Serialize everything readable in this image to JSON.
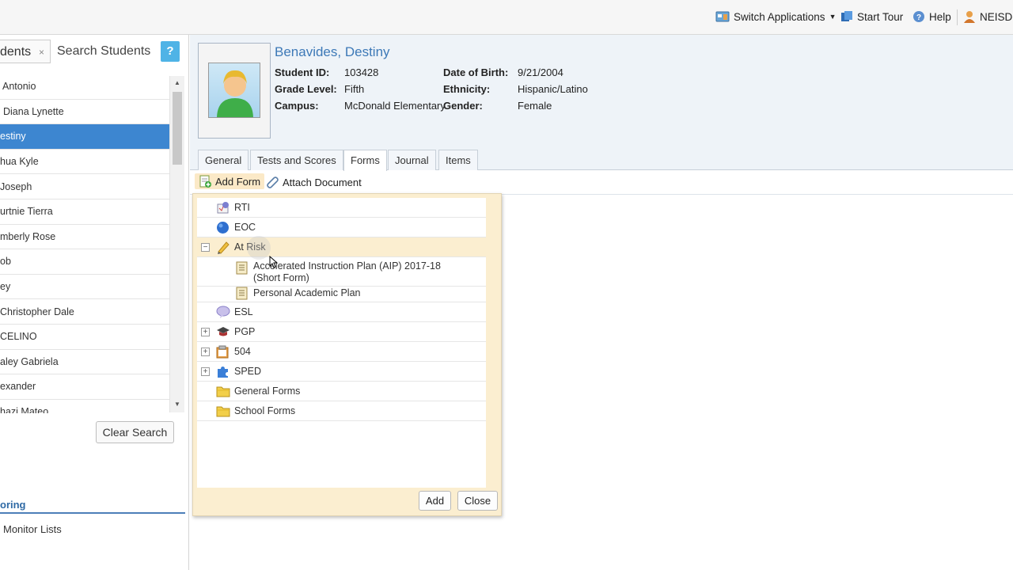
{
  "topbar": {
    "switch_apps": "Switch Applications",
    "start_tour": "Start Tour",
    "help": "Help",
    "user": "NEISD"
  },
  "left": {
    "tab_label": "dents",
    "tab_close": "×",
    "search_label": "Search Students",
    "help_btn": "?",
    "students": [
      {
        "name": "Antonio",
        "indent": 3
      },
      {
        "name": "Diana Lynette",
        "indent": 4
      },
      {
        "name": "estiny",
        "indent": 0,
        "selected": true
      },
      {
        "name": "hua Kyle",
        "indent": 0
      },
      {
        "name": "Joseph",
        "indent": 0
      },
      {
        "name": "urtnie Tierra",
        "indent": 0
      },
      {
        "name": "mberly Rose",
        "indent": 0
      },
      {
        "name": "ob",
        "indent": 0
      },
      {
        "name": "ey",
        "indent": 0
      },
      {
        "name": "Christopher Dale",
        "indent": 0
      },
      {
        "name": "CELINO",
        "indent": 0
      },
      {
        "name": "aley Gabriela",
        "indent": 0
      },
      {
        "name": "exander",
        "indent": 0
      },
      {
        "name": "hazi Mateo",
        "indent": 0
      }
    ],
    "clear_search": "Clear Search",
    "section_heading": "oring",
    "monitor_lists": "Monitor Lists"
  },
  "student": {
    "name": "Benavides, Destiny",
    "id_label": "Student ID:",
    "id": "103428",
    "grade_label": "Grade Level:",
    "grade": "Fifth",
    "campus_label": "Campus:",
    "campus": "McDonald Elementary",
    "dob_label": "Date of Birth:",
    "dob": "9/21/2004",
    "ethnicity_label": "Ethnicity:",
    "ethnicity": "Hispanic/Latino",
    "gender_label": "Gender:",
    "gender": "Female"
  },
  "tabs": [
    "General",
    "Tests and Scores",
    "Forms",
    "Journal",
    "Items"
  ],
  "toolbar": {
    "add_form": "Add Form",
    "attach_document": "Attach Document"
  },
  "form_tree": {
    "rti": "RTI",
    "eoc": "EOC",
    "at_risk": "At Risk",
    "aip_line1": "Accelerated Instruction Plan (AIP) 2017-18",
    "aip_line2": "(Short Form)",
    "pap": "Personal Academic Plan",
    "esl": "ESL",
    "pgp": "PGP",
    "f504": "504",
    "sped": "SPED",
    "general_forms": "General Forms",
    "school_forms": "School Forms",
    "expand_symbol": "+",
    "collapse_symbol": "−"
  },
  "popup_buttons": {
    "add": "Add",
    "close": "Close"
  },
  "colors": {
    "selected_row": "#3d86d0",
    "popup_bg": "#fbeed0",
    "name_blue": "#3d79b7"
  }
}
